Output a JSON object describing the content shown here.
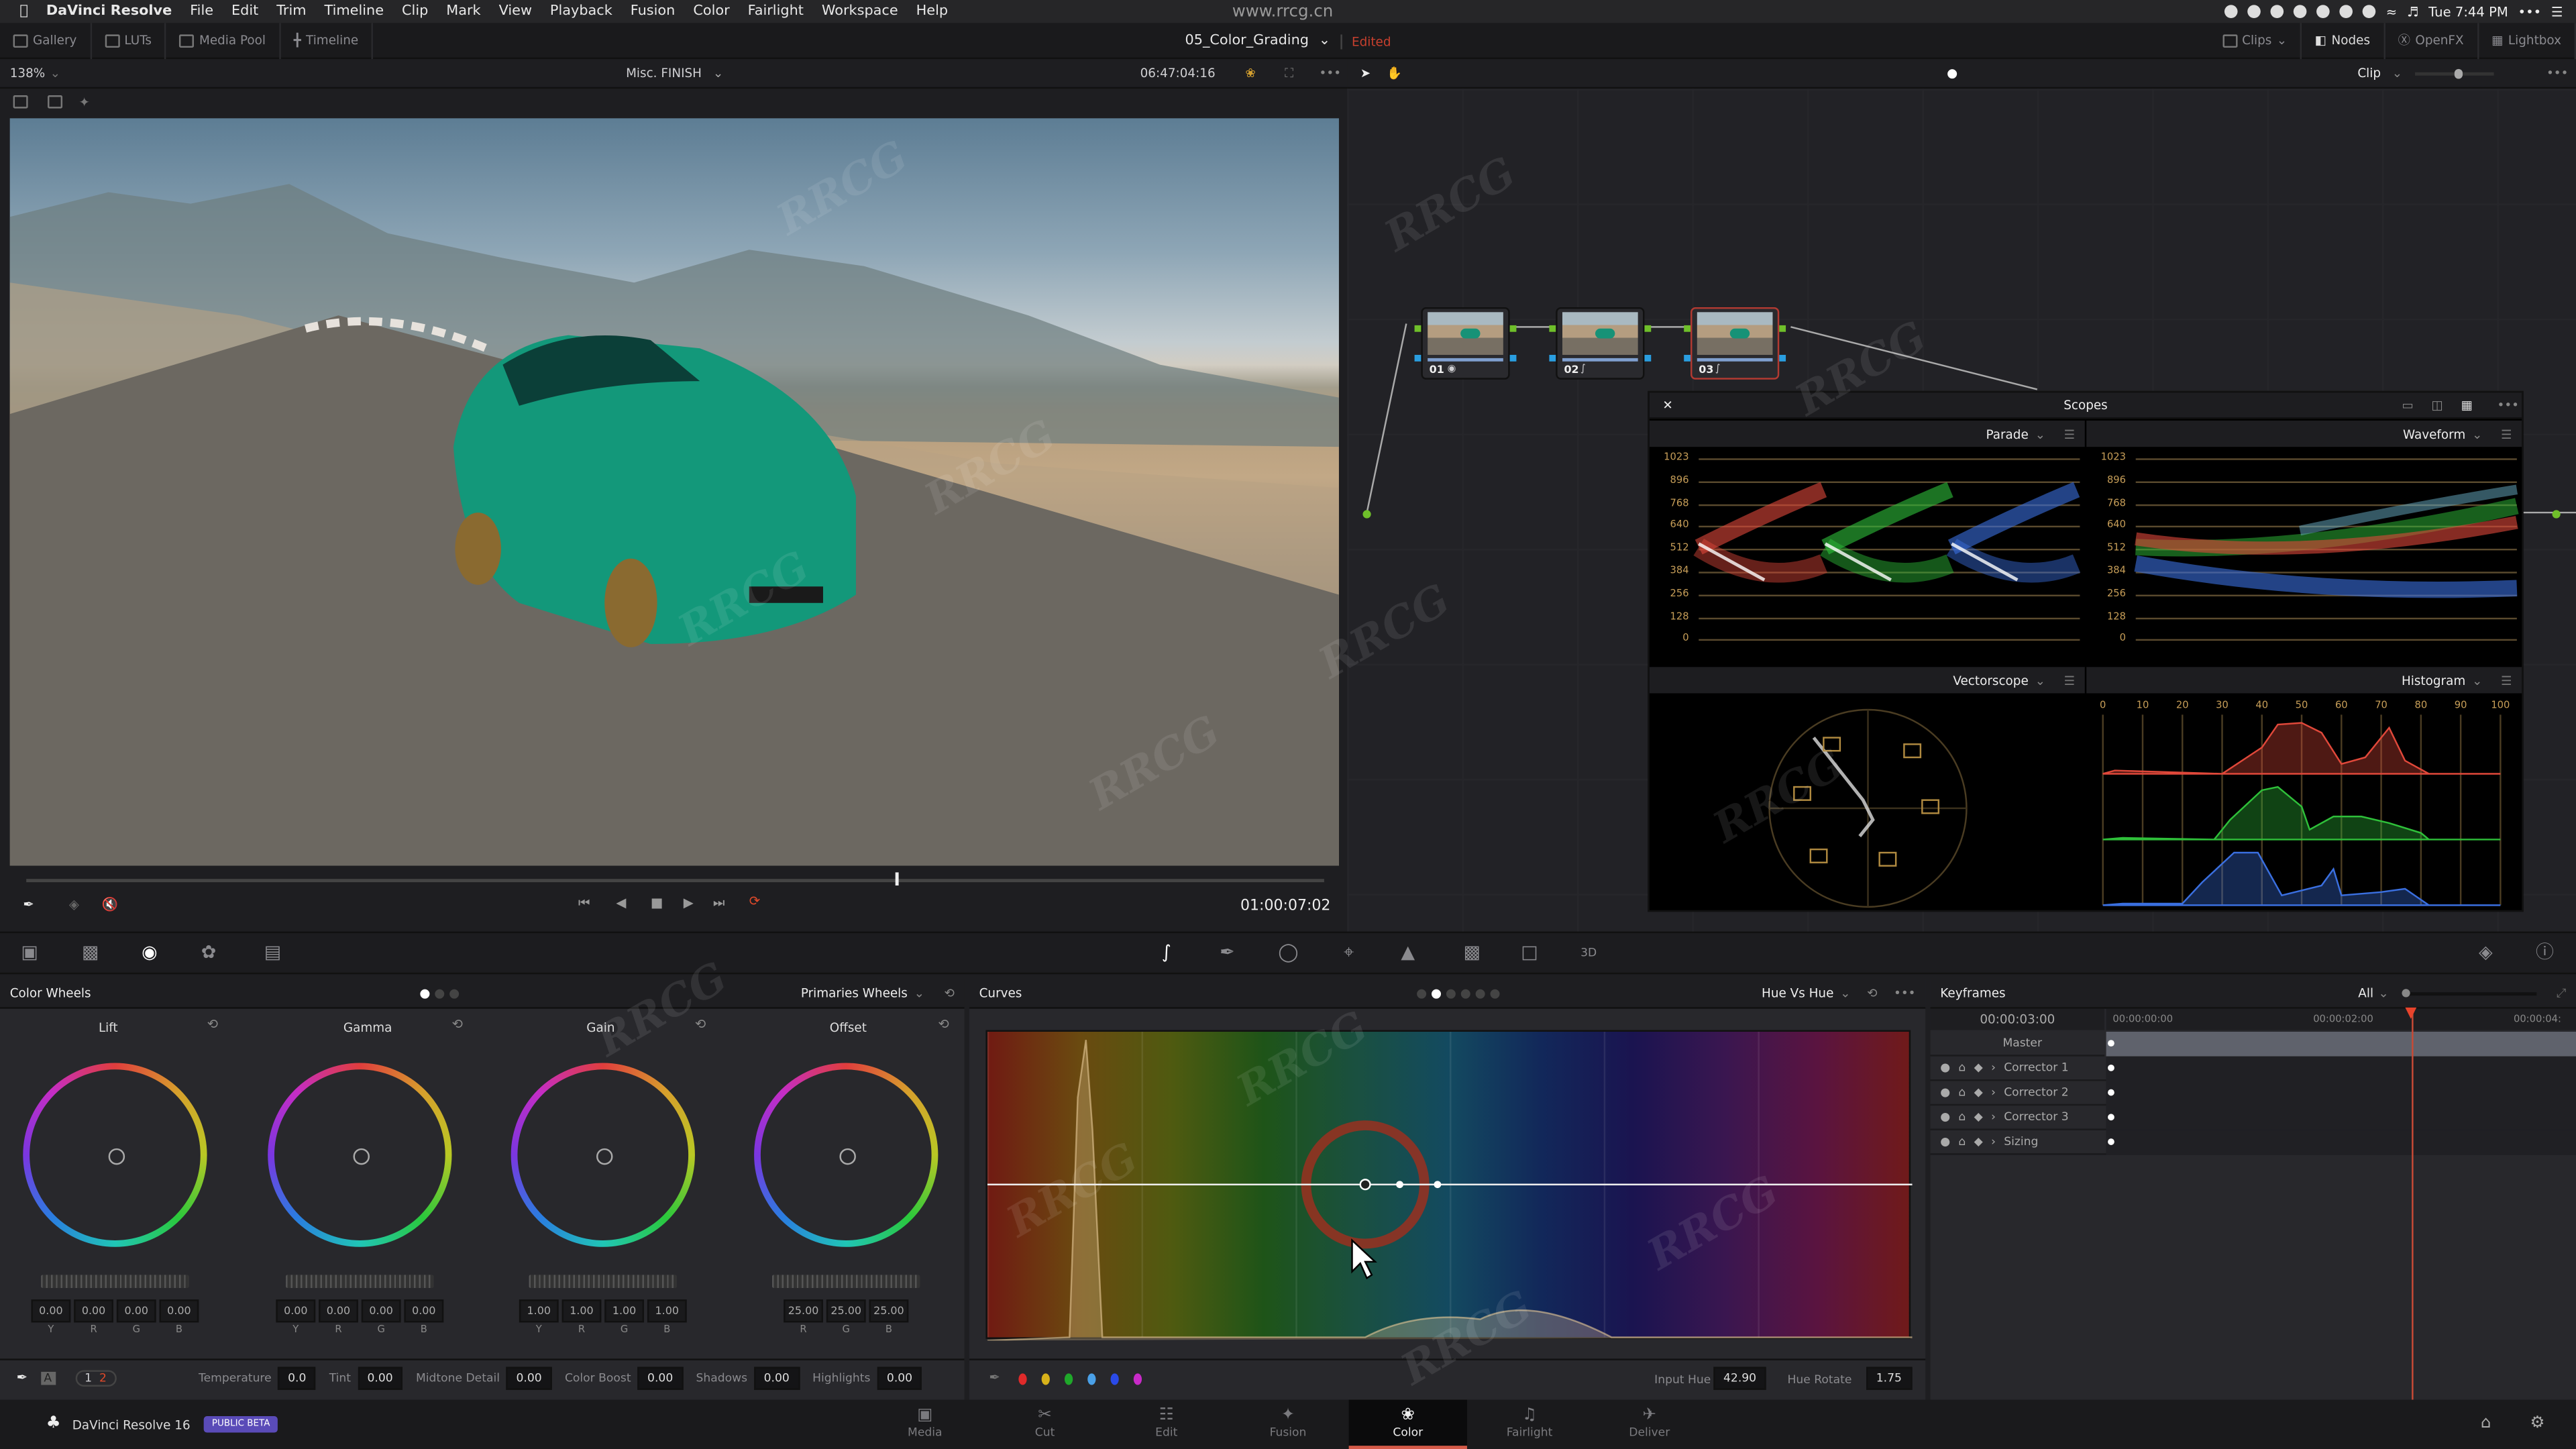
{
  "menubar": {
    "app": "DaVinci Resolve",
    "items": [
      "File",
      "Edit",
      "Trim",
      "Timeline",
      "Clip",
      "Mark",
      "View",
      "Playback",
      "Fusion",
      "Color",
      "Fairlight",
      "Workspace",
      "Help"
    ],
    "clock": "Tue 7:44 PM"
  },
  "toolbar": {
    "left": [
      "Gallery",
      "LUTs",
      "Media Pool",
      "Timeline"
    ],
    "right": [
      "Clips",
      "Nodes",
      "OpenFX",
      "Lightbox"
    ]
  },
  "project": {
    "title": "05_Color_Grading",
    "status": "Edited"
  },
  "watermark": "www.rrcg.cn",
  "viewer": {
    "zoom": "138%",
    "clip_name": "Misc. FINISH",
    "source_timecode": "06:47:04:16",
    "timecode": "01:00:07:02",
    "playhead_fraction": 0.67
  },
  "nodes_header": {
    "mode": "Clip"
  },
  "nodes": [
    {
      "label": "01"
    },
    {
      "label": "02"
    },
    {
      "label": "03",
      "selected": true
    }
  ],
  "scopes": {
    "title": "Scopes",
    "left_top": "Parade",
    "right_top": "Waveform",
    "left_bottom": "Vectorscope",
    "right_bottom": "Histogram",
    "wave_ticks": [
      "1023",
      "896",
      "768",
      "640",
      "512",
      "384",
      "256",
      "128",
      "0"
    ],
    "hist_ticks": [
      "0",
      "10",
      "20",
      "30",
      "40",
      "50",
      "60",
      "70",
      "80",
      "90",
      "100"
    ],
    "channel_colors": {
      "red": "#e0483a",
      "green": "#2fc03a",
      "blue": "#3a6fe0"
    }
  },
  "color_wheels": {
    "title": "Color Wheels",
    "mode": "Primaries Wheels",
    "wheels": [
      {
        "name": "Lift",
        "values": [
          "0.00",
          "0.00",
          "0.00",
          "0.00"
        ],
        "channels": [
          "Y",
          "R",
          "G",
          "B"
        ]
      },
      {
        "name": "Gamma",
        "values": [
          "0.00",
          "0.00",
          "0.00",
          "0.00"
        ],
        "channels": [
          "Y",
          "R",
          "G",
          "B"
        ]
      },
      {
        "name": "Gain",
        "values": [
          "1.00",
          "1.00",
          "1.00",
          "1.00"
        ],
        "channels": [
          "Y",
          "R",
          "G",
          "B"
        ]
      },
      {
        "name": "Offset",
        "values": [
          "25.00",
          "25.00",
          "25.00"
        ],
        "channels": [
          "R",
          "G",
          "B"
        ]
      }
    ],
    "page_a": "A",
    "page_1": "1",
    "page_2": "2",
    "params": [
      {
        "label": "Temperature",
        "value": "0.0"
      },
      {
        "label": "Tint",
        "value": "0.00"
      },
      {
        "label": "Midtone Detail",
        "value": "0.00"
      },
      {
        "label": "Color Boost",
        "value": "0.00"
      },
      {
        "label": "Shadows",
        "value": "0.00"
      },
      {
        "label": "Highlights",
        "value": "0.00"
      }
    ]
  },
  "curves": {
    "title": "Curves",
    "mode": "Hue Vs Hue",
    "input_hue_label": "Input Hue",
    "input_hue": "42.90",
    "hue_rotate_label": "Hue Rotate",
    "hue_rotate": "1.75",
    "swatches": [
      "#e02a2a",
      "#d8b21a",
      "#1fa82a",
      "#4aa0e8",
      "#2a4ae8",
      "#c82ac8"
    ]
  },
  "keyframes": {
    "title": "Keyframes",
    "filter": "All",
    "current": "00:00:03:00",
    "ruler": [
      "00:00:00:00",
      "00:00:02:00",
      "00:00:04:"
    ],
    "rows": [
      "Master",
      "Corrector 1",
      "Corrector 2",
      "Corrector 3",
      "Sizing"
    ]
  },
  "footer": {
    "app": "DaVinci Resolve 16",
    "badge": "PUBLIC BETA",
    "badge_color": "#5a4bb8",
    "pages": [
      "Media",
      "Cut",
      "Edit",
      "Fusion",
      "Color",
      "Fairlight",
      "Deliver"
    ],
    "active": "Color"
  }
}
